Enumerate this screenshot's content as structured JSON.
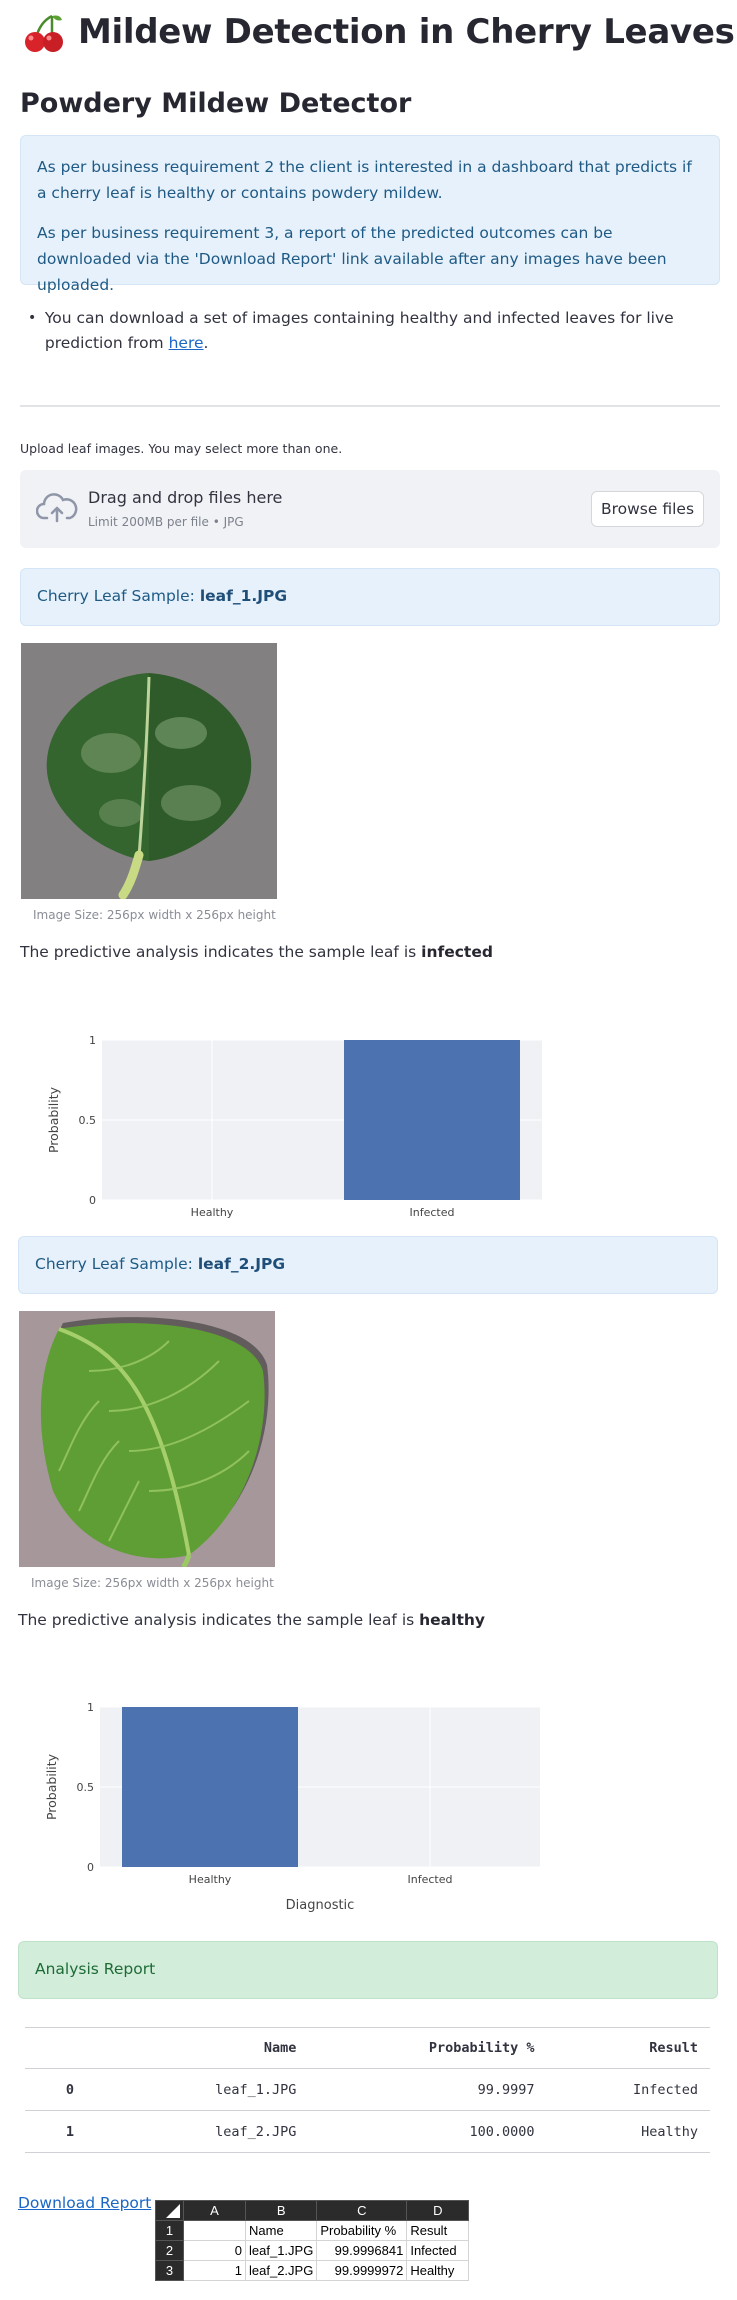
{
  "app": {
    "title": "Mildew Detection in Cherry Leaves",
    "page_title": "Powdery Mildew Detector"
  },
  "intro": {
    "paragraph_1": "As per business requirement 2 the client is interested in a dashboard that predicts if a cherry leaf is healthy or contains powdery mildew.",
    "paragraph_2": "As per business requirement 3, a report of the predicted outcomes can be downloaded via the 'Download Report' link available after any images have been uploaded.",
    "bullet_text": "You can download a set of images containing healthy and infected leaves for live prediction from ",
    "bullet_link": "here",
    "bullet_end": "."
  },
  "uploader": {
    "label": "Upload leaf images. You may select more than one.",
    "drop_text": "Drag and drop files here",
    "limit_text": "Limit 200MB per file • JPG",
    "browse_label": "Browse files"
  },
  "samples": [
    {
      "prefix": "Cherry Leaf Sample: ",
      "filename": "leaf_1.JPG",
      "caption": "Image Size: 256px width x 256px height",
      "verdict_prefix": "The predictive analysis indicates the sample leaf is ",
      "verdict": "infected"
    },
    {
      "prefix": "Cherry Leaf Sample: ",
      "filename": "leaf_2.JPG",
      "caption": "Image Size: 256px width x 256px height",
      "verdict_prefix": "The predictive analysis indicates the sample leaf is ",
      "verdict": "healthy"
    }
  ],
  "chart_data": [
    {
      "type": "bar",
      "categories": [
        "Healthy",
        "Infected"
      ],
      "values": [
        0,
        1
      ],
      "ylabel": "Probability",
      "xlabel": "",
      "ylim": [
        0,
        1
      ],
      "yticks": [
        "0",
        "0.5",
        "1"
      ],
      "bar_color": "#4c72b0",
      "plot_bg": "#eff1f5"
    },
    {
      "type": "bar",
      "categories": [
        "Healthy",
        "Infected"
      ],
      "values": [
        1,
        0
      ],
      "ylabel": "Probability",
      "xlabel": "Diagnostic",
      "ylim": [
        0,
        1
      ],
      "yticks": [
        "0",
        "0.5",
        "1"
      ],
      "bar_color": "#4c72b0",
      "plot_bg": "#eff1f5"
    }
  ],
  "report": {
    "title": "Analysis Report",
    "columns": [
      "",
      "Name",
      "Probability %",
      "Result"
    ],
    "rows": [
      [
        "0",
        "leaf_1.JPG",
        "99.9997",
        "Infected"
      ],
      [
        "1",
        "leaf_2.JPG",
        "100.0000",
        "Healthy"
      ]
    ],
    "download_label": "Download Report"
  },
  "spreadsheet": {
    "col_headers": [
      "A",
      "B",
      "C",
      "D"
    ],
    "row_headers": [
      "1",
      "2",
      "3"
    ],
    "rows": [
      [
        "",
        "Name",
        "Probability %",
        "Result"
      ],
      [
        "0",
        "leaf_1.JPG",
        "99.9996841",
        "Infected"
      ],
      [
        "1",
        "leaf_2.JPG",
        "99.9999972",
        "Healthy"
      ]
    ]
  }
}
